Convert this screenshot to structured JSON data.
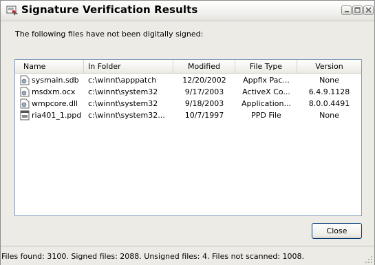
{
  "window": {
    "title": "Signature Verification Results",
    "title_icon": "certificate-icon",
    "buttons": [
      "minimize-icon",
      "maximize-icon",
      "close-icon"
    ]
  },
  "intro_text": "The following files have not been digitally signed:",
  "list": {
    "columns": [
      "Name",
      "In Folder",
      "Modified",
      "File Type",
      "Version"
    ],
    "rows": [
      {
        "name": "sysmain.sdb",
        "folder": "c:\\winnt\\apppatch",
        "modified": "12/20/2002",
        "type": "Appfix Pac...",
        "version": "None",
        "icon": "file-icon"
      },
      {
        "name": "msdxm.ocx",
        "folder": "c:\\winnt\\system32",
        "modified": "9/17/2003",
        "type": "ActiveX Co...",
        "version": "6.4.9.1128",
        "icon": "file-icon"
      },
      {
        "name": "wmpcore.dll",
        "folder": "c:\\winnt\\system32",
        "modified": "9/18/2003",
        "type": "Application...",
        "version": "8.0.0.4491",
        "icon": "file-icon"
      },
      {
        "name": "ria401_1.ppd",
        "folder": "c:\\winnt\\system32...",
        "modified": "10/7/1997",
        "type": "PPD File",
        "version": "None",
        "icon": "ppd-file-icon"
      }
    ]
  },
  "close_label": "Close",
  "status": "Files found: 3100.  Signed files: 2088.  Unsigned files: 4.  Files not scanned: 1008."
}
